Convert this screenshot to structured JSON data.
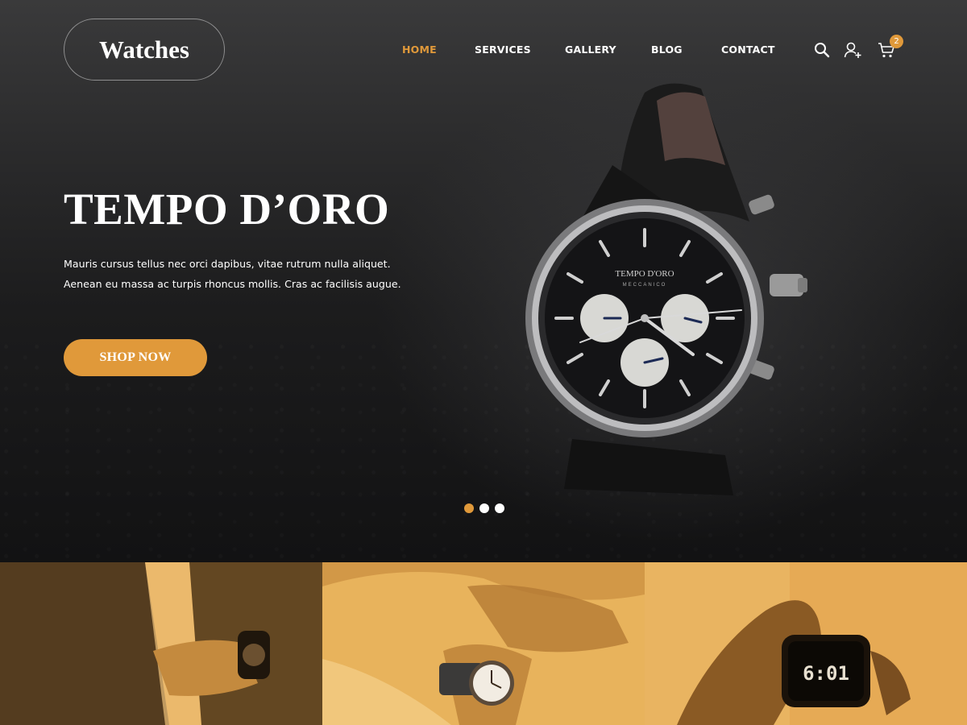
{
  "header": {
    "logo": "Watches",
    "nav": [
      {
        "label": "HOME",
        "active": true
      },
      {
        "label": "SERVICES",
        "active": false
      },
      {
        "label": "GALLERY",
        "active": false
      },
      {
        "label": "BLOG",
        "active": false
      },
      {
        "label": "CONTACT",
        "active": false
      }
    ],
    "icons": [
      "search-icon",
      "user-add-icon",
      "cart-icon"
    ],
    "cart_count": "2"
  },
  "hero": {
    "title": "TEMPO D’ORO",
    "description": "Mauris cursus tellus nec orci dapibus, vitae rutrum nulla aliquet. Aenean eu massa ac turpis rhoncus mollis. Cras ac facilisis augue.",
    "cta_label": "SHOP NOW",
    "watch_brand": "TEMPO D'ORO",
    "watch_sub": "MECCANICO",
    "slides": 3,
    "active_slide": 1
  },
  "tiles": {
    "digital_watch_readout": "6:01"
  },
  "colors": {
    "accent": "#e0993a",
    "hero_bg": "#1e1e1f",
    "tile_tint": "#e2a649",
    "text": "#ffffff"
  }
}
